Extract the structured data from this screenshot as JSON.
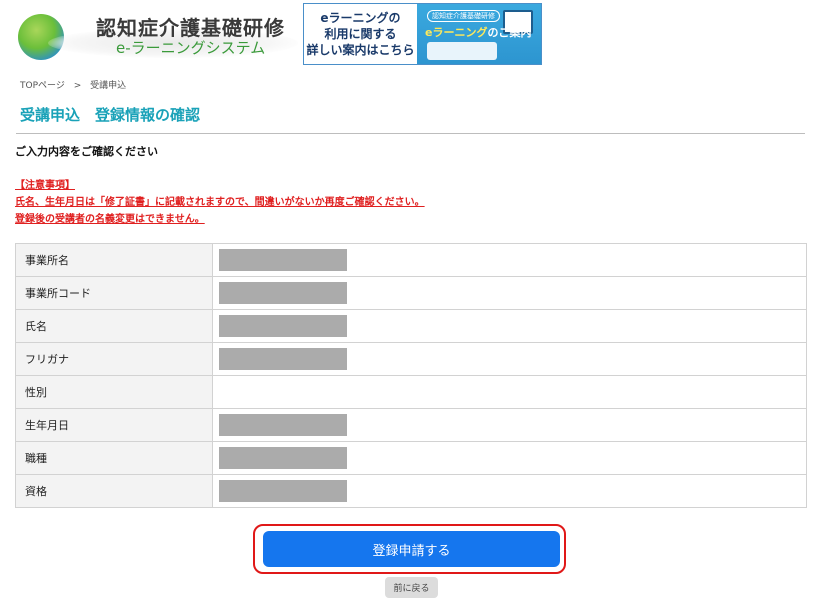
{
  "header": {
    "logo_title": "認知症介護基礎研修",
    "logo_subtitle": "e-ラーニングシステム",
    "banner": {
      "left_line1": "eラーニングの",
      "left_line2": "利用に関する",
      "left_line3": "詳しい案内はこちら",
      "tag": "認知症介護基礎研修",
      "headline_a": "eラーニング",
      "headline_b": "のご案内"
    }
  },
  "breadcrumb": {
    "top": "TOPページ",
    "separator": ">",
    "current": "受講申込"
  },
  "page": {
    "title": "受講申込　登録情報の確認",
    "instruction": "ご入力内容をご確認ください"
  },
  "notice": {
    "heading": "【注意事項】",
    "line1": "氏名、生年月日は「修了証書」に記載されますので、間違いがないか再度ご確認ください。",
    "line2": "登録後の受講者の名義変更はできません。"
  },
  "form_rows": [
    {
      "label": "事業所名",
      "redacted": true
    },
    {
      "label": "事業所コード",
      "redacted": true
    },
    {
      "label": "氏名",
      "redacted": true
    },
    {
      "label": "フリガナ",
      "redacted": true
    },
    {
      "label": "性別",
      "redacted": false
    },
    {
      "label": "生年月日",
      "redacted": true
    },
    {
      "label": "職種",
      "redacted": true
    },
    {
      "label": "資格",
      "redacted": true
    }
  ],
  "actions": {
    "submit_label": "登録申請する",
    "back_label": "前に戻る"
  },
  "colors": {
    "title": "#1aa2b8",
    "notice": "#e02020",
    "submit": "#1576ee",
    "highlight_frame": "#e01818",
    "redaction": "#ababab"
  }
}
